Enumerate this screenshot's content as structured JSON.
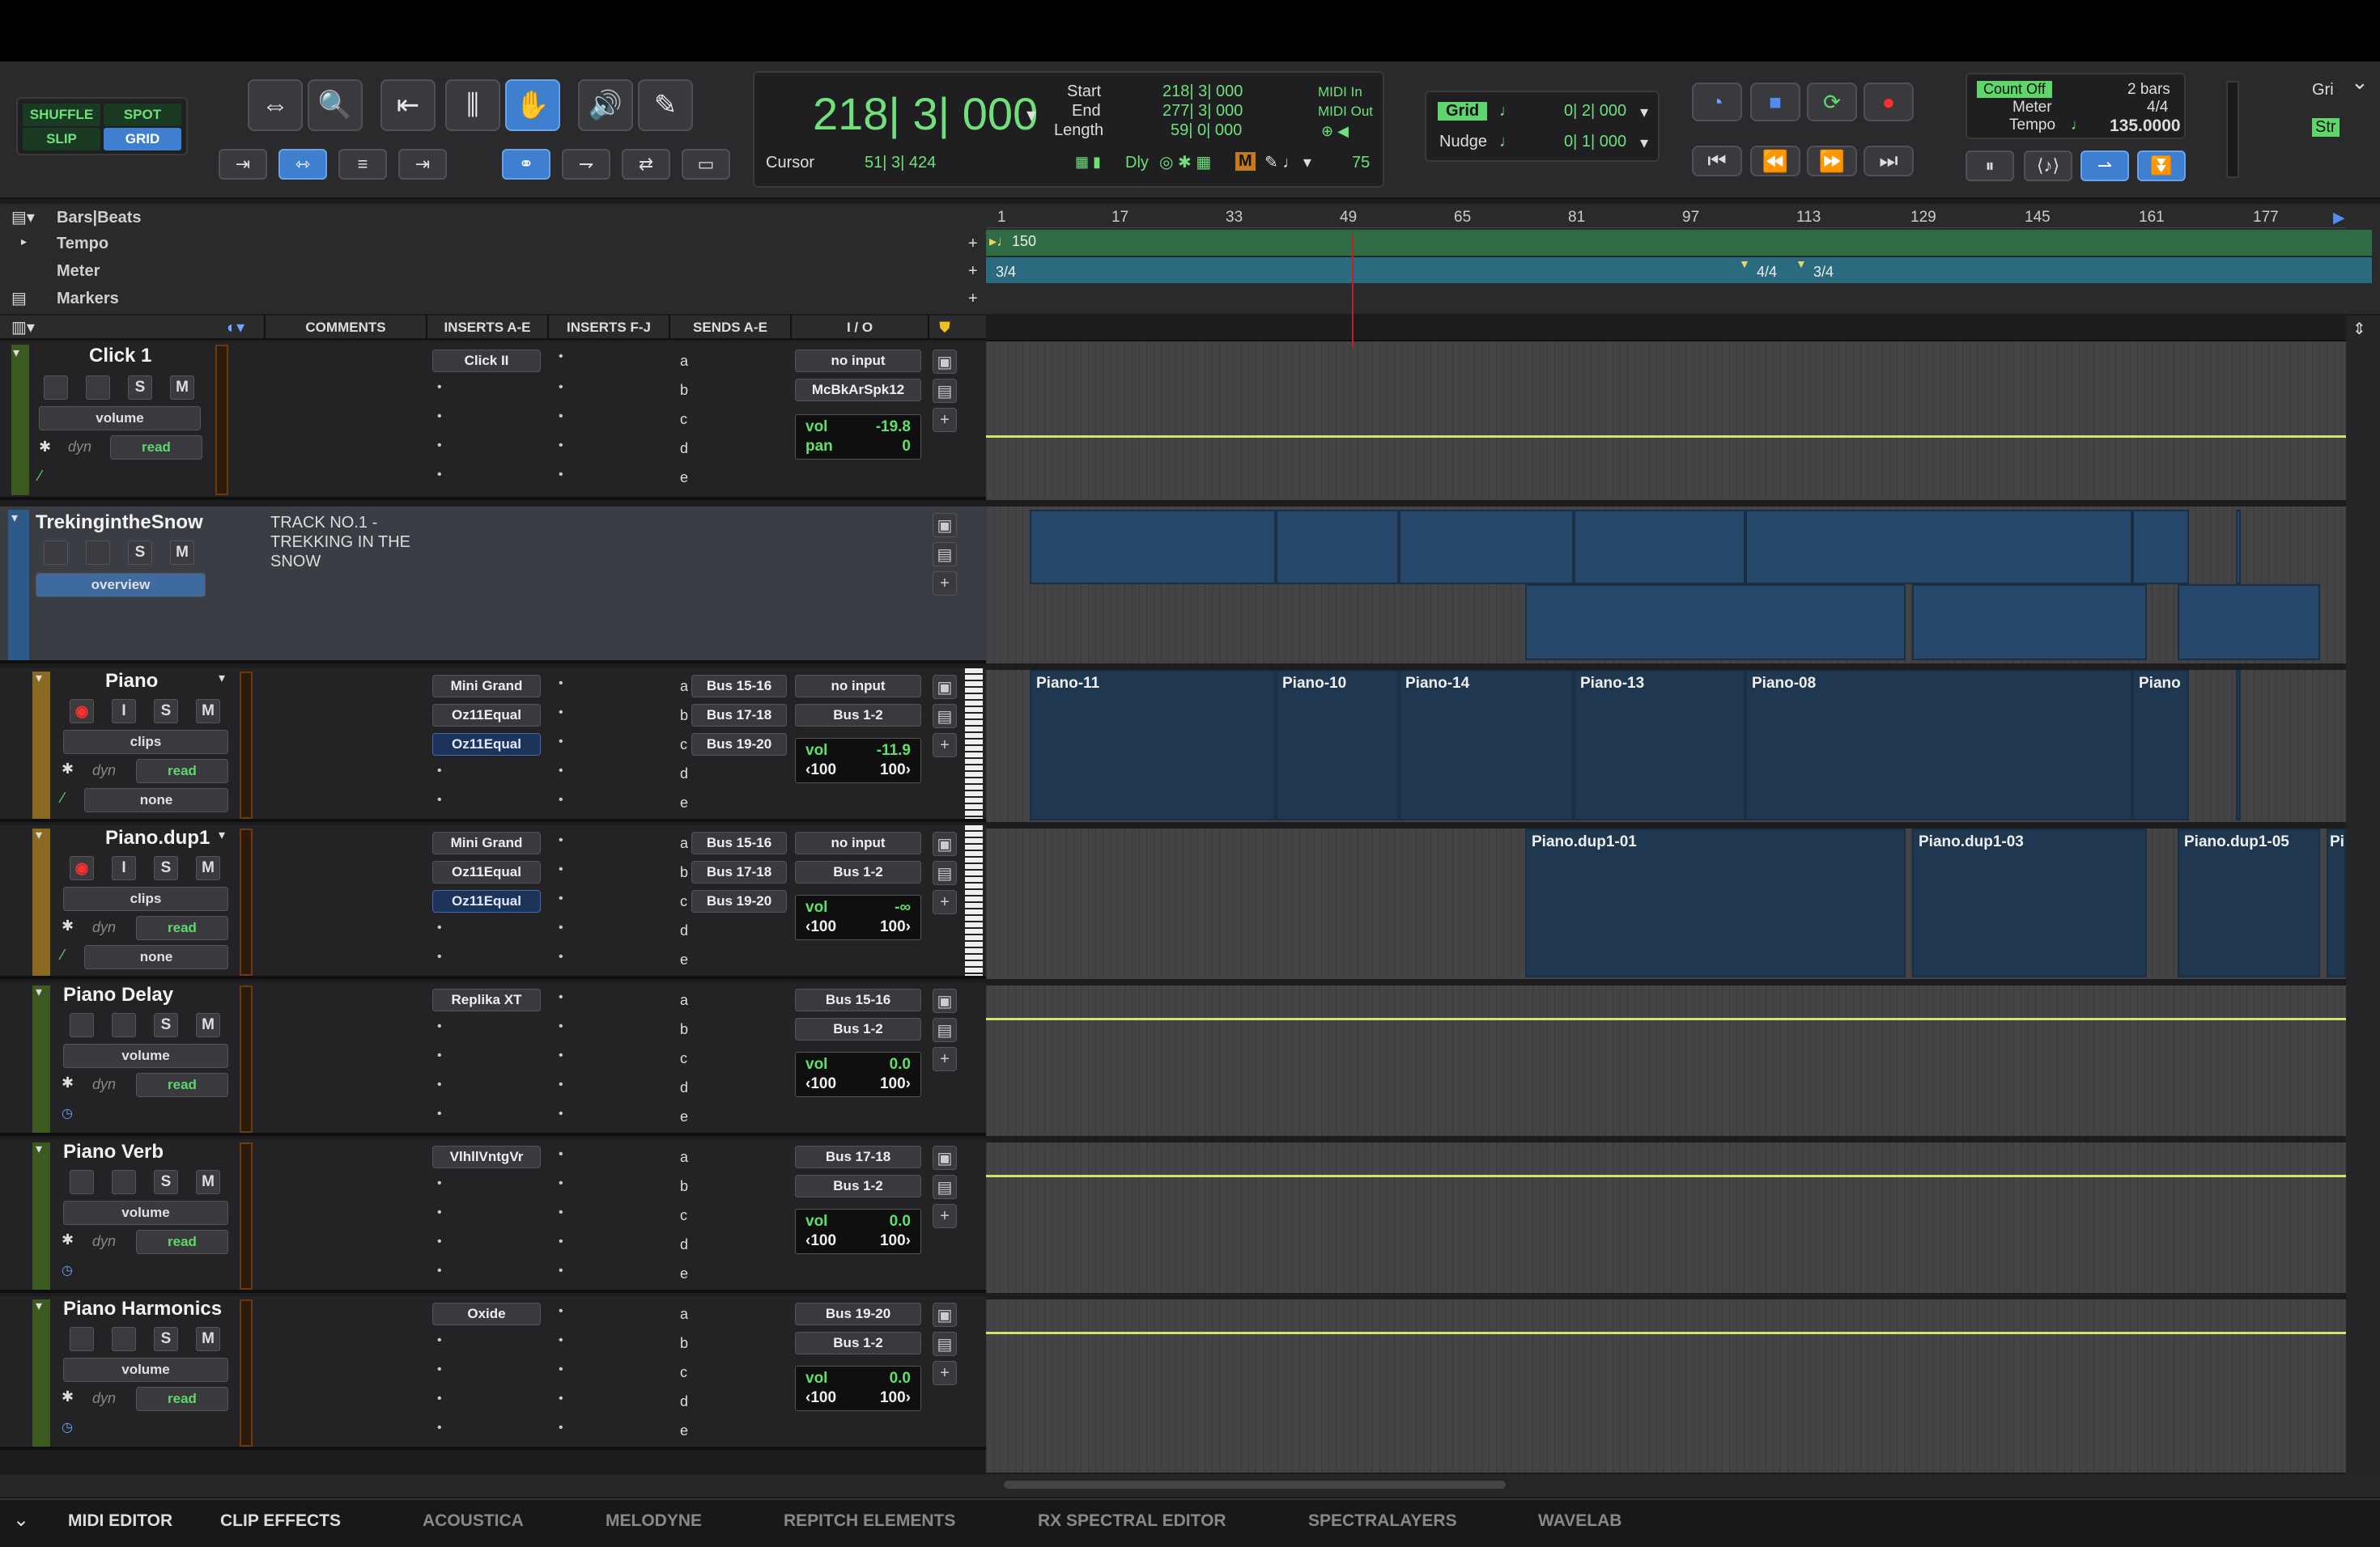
{
  "edit_modes": {
    "shuffle": "SHUFFLE",
    "spot": "SPOT",
    "slip": "SLIP",
    "grid": "GRID"
  },
  "counter": {
    "main": "218| 3| 000",
    "cursor_label": "Cursor",
    "cursor_value": "51| 3| 424",
    "start_label": "Start",
    "start_value": "218| 3| 000",
    "end_label": "End",
    "end_value": "277| 3| 000",
    "length_label": "Length",
    "length_value": "59| 0| 000",
    "midi_in": "MIDI In",
    "midi_out": "MIDI Out",
    "dly": "Dly",
    "velocity": "75"
  },
  "grid_nudge": {
    "grid_label": "Grid",
    "grid_value": "0| 2| 000",
    "nudge_label": "Nudge",
    "nudge_value": "0| 1| 000"
  },
  "tempo_panel": {
    "count_off": "Count Off",
    "bars": "2 bars",
    "meter_label": "Meter",
    "meter_value": "4/4",
    "tempo_label": "Tempo",
    "tempo_value": "135.0000"
  },
  "rulers": {
    "bars_beats": "Bars|Beats",
    "tempo": "Tempo",
    "meter": "Meter",
    "markers": "Markers",
    "bar_numbers": [
      "1",
      "17",
      "33",
      "49",
      "65",
      "81",
      "97",
      "113",
      "129",
      "145",
      "161",
      "177"
    ],
    "tempo_marker": "150",
    "meter_markers": [
      "3/4",
      "4/4",
      "3/4"
    ]
  },
  "columns": {
    "comments": "COMMENTS",
    "inserts_ae": "INSERTS A-E",
    "inserts_fj": "INSERTS F-J",
    "sends_ae": "SENDS A-E",
    "io": "I / O"
  },
  "tracks": [
    {
      "name": "Click 1",
      "view": "volume",
      "mode": "read",
      "inserts": [
        "Click II"
      ],
      "sends": [],
      "io_in": "no input",
      "io_out": "McBkArSpk12",
      "vol": "-19.8",
      "pan_label": "pan",
      "pan": "0"
    },
    {
      "name": "TrekingintheSnow",
      "view": "overview",
      "comment": "TRACK NO.1 - TREKKING IN THE SNOW"
    },
    {
      "name": "Piano",
      "view": "clips",
      "mode": "read",
      "none": "none",
      "inserts": [
        "Mini Grand",
        "Oz11Equal",
        "Oz11Equal"
      ],
      "sends": [
        "Bus 15-16",
        "Bus 17-18",
        "Bus 19-20"
      ],
      "io_in": "no input",
      "io_out": "Bus 1-2",
      "vol": "-11.9",
      "pan_l": "100",
      "pan_r": "100"
    },
    {
      "name": "Piano.dup1",
      "view": "clips",
      "mode": "read",
      "none": "none",
      "inserts": [
        "Mini Grand",
        "Oz11Equal",
        "Oz11Equal"
      ],
      "sends": [
        "Bus 15-16",
        "Bus 17-18",
        "Bus 19-20"
      ],
      "io_in": "no input",
      "io_out": "Bus 1-2",
      "vol": "-∞",
      "pan_l": "100",
      "pan_r": "100"
    },
    {
      "name": "Piano Delay",
      "view": "volume",
      "mode": "read",
      "inserts": [
        "Replika XT"
      ],
      "io_in": "Bus 15-16",
      "io_out": "Bus 1-2",
      "vol": "0.0",
      "pan_l": "100",
      "pan_r": "100"
    },
    {
      "name": "Piano Verb",
      "view": "volume",
      "mode": "read",
      "inserts": [
        "VlhllVntgVr"
      ],
      "io_in": "Bus 17-18",
      "io_out": "Bus 1-2",
      "vol": "0.0",
      "pan_l": "100",
      "pan_r": "100"
    },
    {
      "name": "Piano Harmonics",
      "view": "volume",
      "mode": "read",
      "inserts": [
        "Oxide"
      ],
      "io_in": "Bus 19-20",
      "io_out": "Bus 1-2",
      "vol": "0.0",
      "pan_l": "100",
      "pan_r": "100"
    }
  ],
  "send_letters": [
    "a",
    "b",
    "c",
    "d",
    "e"
  ],
  "labels": {
    "vol": "vol",
    "dyn": "dyn",
    "S": "S",
    "M": "M",
    "I": "I"
  },
  "clips": {
    "piano": [
      "Piano-11",
      "Piano-10",
      "Piano-14",
      "Piano-13",
      "Piano-08",
      "Piano"
    ],
    "piano_dup": [
      "Piano.dup1-01",
      "Piano.dup1-03",
      "Piano.dup1-05",
      "Pi"
    ]
  },
  "bottom_tabs": [
    "MIDI EDITOR",
    "CLIP EFFECTS",
    "ACOUSTICA",
    "MELODYNE",
    "REPITCH ELEMENTS",
    "RX SPECTRAL EDITOR",
    "SPECTRALAYERS",
    "WAVELAB"
  ],
  "right_edge": {
    "gri": "Gri",
    "str": "Str"
  },
  "colors": {
    "accent": "#3f7fcf",
    "green": "#5fe06a",
    "clip": "#25486b",
    "automation": "#d4e46a"
  }
}
